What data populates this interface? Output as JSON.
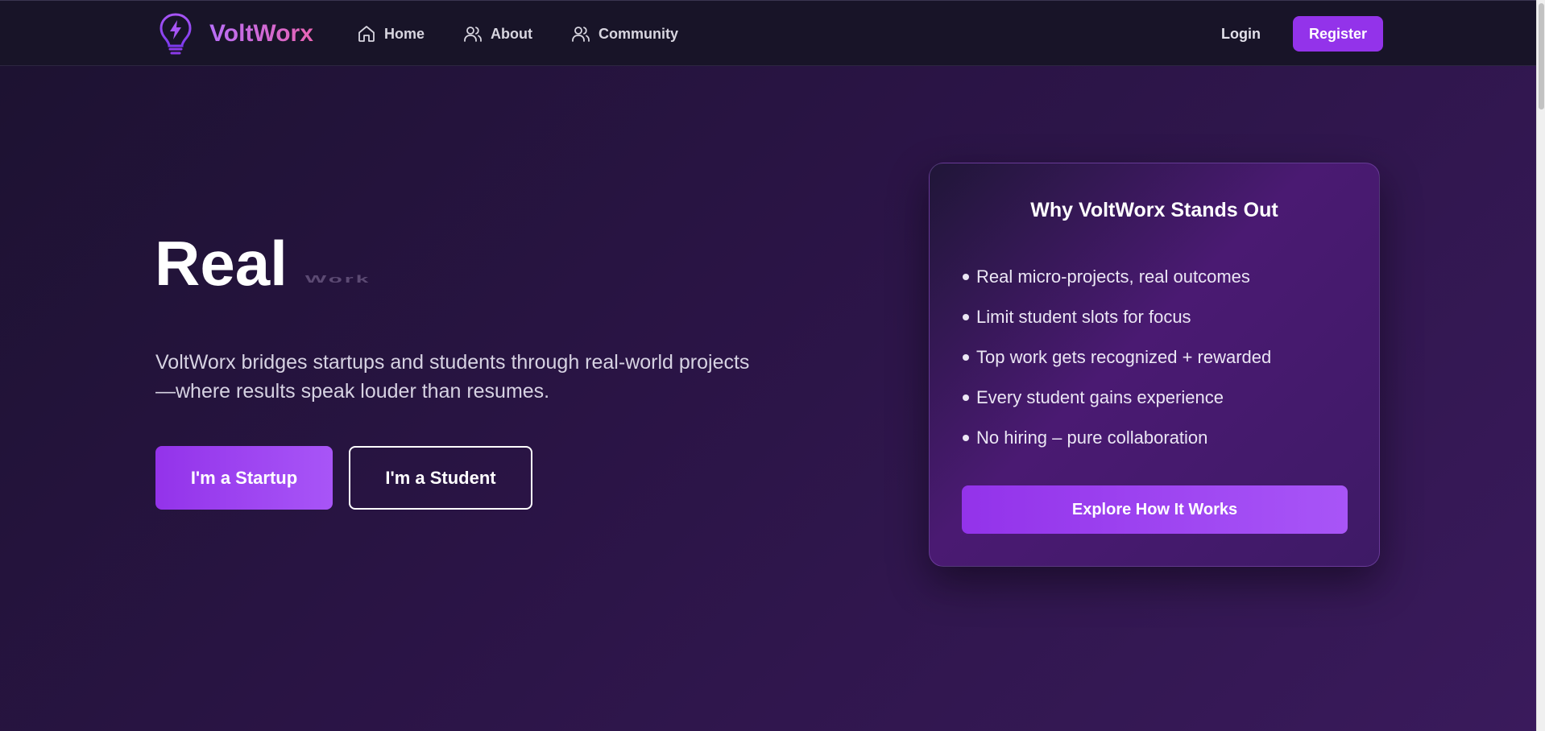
{
  "colors": {
    "accent": "#9333ea",
    "accent_light": "#a855f7",
    "background": "#1c1230",
    "brand_gradient_start": "#b86ef7",
    "brand_gradient_end": "#e864b4"
  },
  "header": {
    "brand": {
      "name": "VoltWorx",
      "logo_icon": "lightbulb-bolt-icon"
    },
    "nav": [
      {
        "label": "Home",
        "icon": "home-icon"
      },
      {
        "label": "About",
        "icon": "users-icon"
      },
      {
        "label": "Community",
        "icon": "users-icon"
      }
    ],
    "login_label": "Login",
    "register_label": "Register"
  },
  "hero": {
    "title_main": "Real",
    "title_animated_word": "Work",
    "subtitle": "VoltWorx bridges startups and students through real-world projects—where results speak louder than resumes.",
    "cta_startup": "I'm a Startup",
    "cta_student": "I'm a Student"
  },
  "card": {
    "title": "Why VoltWorx Stands Out",
    "items": [
      "Real micro-projects, real outcomes",
      "Limit student slots for focus",
      "Top work gets recognized + rewarded",
      "Every student gains experience",
      "No hiring – pure collaboration"
    ],
    "button_label": "Explore How It Works"
  }
}
